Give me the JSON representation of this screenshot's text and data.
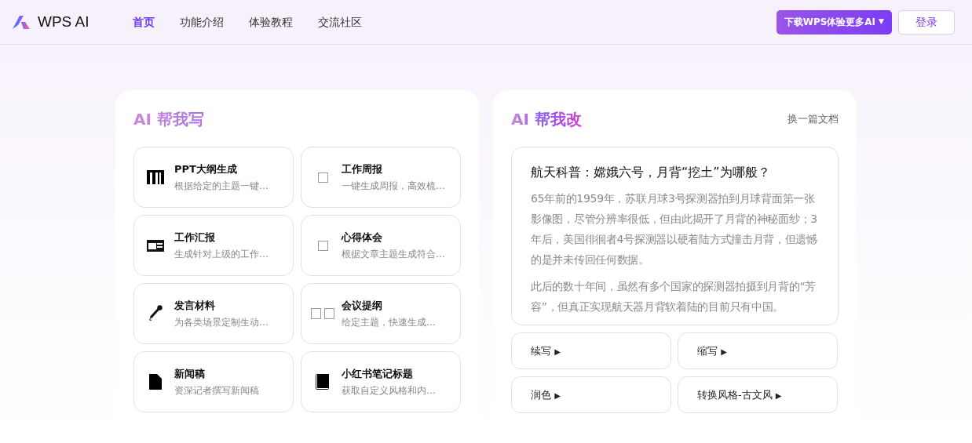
{
  "brand": "WPS AI",
  "nav": [
    {
      "label": "首页",
      "selected": true
    },
    {
      "label": "功能介绍",
      "selected": false
    },
    {
      "label": "体验教程",
      "selected": false
    },
    {
      "label": "交流社区",
      "selected": false
    }
  ],
  "download_button": {
    "label": "下载WPS体验更多AI",
    "caret": "▼"
  },
  "login_button": "登录",
  "write_panel": {
    "title": "AI 帮我写",
    "items": [
      {
        "kind": "columns",
        "title": "PPT大纲生成",
        "desc": "根据给定的主题一键…"
      },
      {
        "kind": "square",
        "title": "工作周报",
        "desc": "一键生成周报，高效梳…"
      },
      {
        "kind": "newspaper",
        "title": "工作汇报",
        "desc": "生成针对上级的工作…"
      },
      {
        "kind": "square",
        "title": "心得体会",
        "desc": "根据文章主题生成符合…"
      },
      {
        "kind": "microphone",
        "title": "发言材料",
        "desc": "为各类场景定制生动…"
      },
      {
        "kind": "squares",
        "title": "会议提纲",
        "desc": "给定主题，快速生成…"
      },
      {
        "kind": "file",
        "title": "新闻稿",
        "desc": "资深记者撰写新闻稿"
      },
      {
        "kind": "book",
        "title": "小红书笔记标题",
        "desc": "获取自定义风格和内…"
      }
    ]
  },
  "edit_panel": {
    "title": "AI 帮我改",
    "switch_link": "换一篇文档",
    "article": {
      "title": "航天科普：嫦娥六号，月背“挖土”为哪般？",
      "paragraphs": [
        "65年前的1959年，苏联月球3号探测器拍到月球背面第一张影像图，尽管分辨率很低，但由此揭开了月背的神秘面纱；3年后，美国徘徊者4号探测器以硬着陆方式撞击月背，但遗憾的是并未传回任何数据。",
        "此后的数十年间，虽然有多个国家的探测器拍摄到月背的“芳容”，但真正实现航天器月背软着陆的目前只有中国。"
      ]
    },
    "actions": [
      {
        "label": "续写",
        "arrow": "▶"
      },
      {
        "label": "缩写",
        "arrow": "▶"
      },
      {
        "label": "润色",
        "arrow": "▶"
      },
      {
        "label": "转换风格-古文风",
        "arrow": "▶"
      }
    ]
  }
}
